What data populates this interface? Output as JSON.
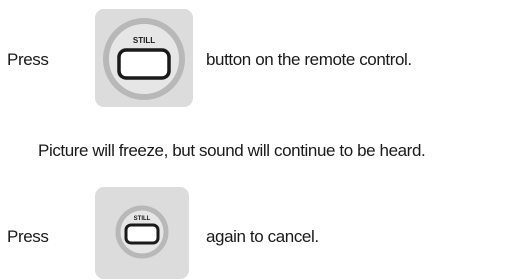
{
  "step1": {
    "prefix": "Press",
    "suffix": "button on the remote control.",
    "button_label": "STILL",
    "button_icon": "still-button-icon"
  },
  "note": "Picture will freeze, but sound will continue to be heard.",
  "step2": {
    "prefix": "Press",
    "suffix": "again to cancel.",
    "button_label": "STILL",
    "button_icon": "still-button-icon"
  },
  "colors": {
    "button_background": "#dcdcdc",
    "ring": "#b8b8b8",
    "button_outline": "#1a1a1a",
    "text": "#1a1a1a"
  }
}
